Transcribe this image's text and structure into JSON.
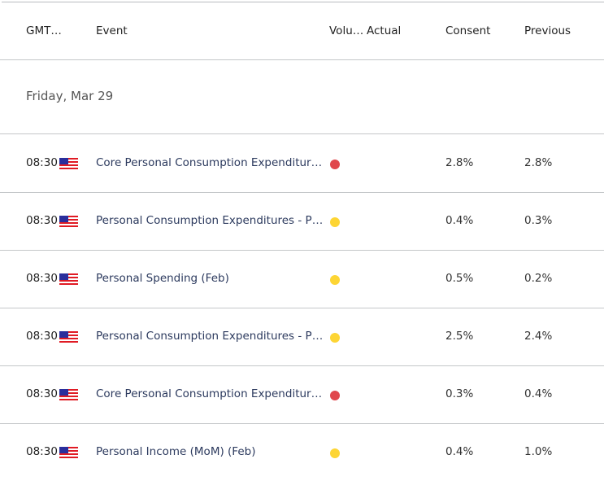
{
  "header": {
    "gmt": "GMT…",
    "event": "Event",
    "volume": "Volu…",
    "actual": "Actual",
    "consensus": "Consent",
    "previous": "Previous"
  },
  "date": "Friday, Mar 29",
  "colors": {
    "high": "#e0474c",
    "medium": "#fdd534"
  },
  "rows": [
    {
      "time": "08:30",
      "flag": "us-flag-icon",
      "event": "Core Personal Consumption Expenditures - Price Index (YoY) (Feb)",
      "event_display": "Core Personal Consumption Expenditur…",
      "volatility": "high",
      "actual": "",
      "consensus": "2.8%",
      "previous": "2.8%"
    },
    {
      "time": "08:30",
      "flag": "us-flag-icon",
      "event_display": "Personal Consumption Expenditures - P…",
      "volatility": "medium",
      "actual": "",
      "consensus": "0.4%",
      "previous": "0.3%"
    },
    {
      "time": "08:30",
      "flag": "us-flag-icon",
      "event_display": "Personal Spending (Feb)",
      "volatility": "medium",
      "actual": "",
      "consensus": "0.5%",
      "previous": "0.2%"
    },
    {
      "time": "08:30",
      "flag": "us-flag-icon",
      "event_display": "Personal Consumption Expenditures - P…",
      "volatility": "medium",
      "actual": "",
      "consensus": "2.5%",
      "previous": "2.4%"
    },
    {
      "time": "08:30",
      "flag": "us-flag-icon",
      "event_display": "Core Personal Consumption Expenditur…",
      "volatility": "high",
      "actual": "",
      "consensus": "0.3%",
      "previous": "0.4%"
    },
    {
      "time": "08:30",
      "flag": "us-flag-icon",
      "event_display": "Personal Income (MoM) (Feb)",
      "volatility": "medium",
      "actual": "",
      "consensus": "0.4%",
      "previous": "1.0%"
    }
  ]
}
